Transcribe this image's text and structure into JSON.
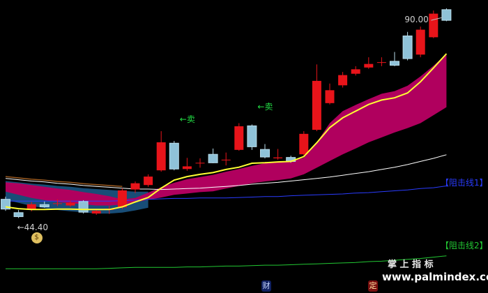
{
  "colors": {
    "background": "#000000",
    "up": "#e8141a",
    "down": "#b8dcea",
    "ma_short": "#ffff33",
    "ma_long": "#ffffff",
    "band": "#b0005e",
    "resist1": "#2a3cff",
    "resist2": "#22c833",
    "sell_text": "#22dd44"
  },
  "labels": {
    "high_price": "90.00",
    "low_price": "←44.40",
    "sell_1": "←卖",
    "sell_2": "←卖",
    "resistance_1": "【阻击线1】",
    "resistance_2": "【阻击线2】",
    "watermark_cn": "掌 上 指 标",
    "watermark_url": "www.palmindex.com",
    "icon_cai": "财",
    "icon_ding": "定",
    "money_bag_icon": "money-bag-icon"
  },
  "chart_data": {
    "type": "candlestick",
    "title": "",
    "ylim": [
      30,
      93
    ],
    "max_label": 90.0,
    "min_label": 44.4,
    "candles": [
      {
        "o": 49.8,
        "c": 47.6,
        "h": 50.4,
        "l": 47.2
      },
      {
        "o": 46.8,
        "c": 45.9,
        "h": 47.4,
        "l": 45.6
      },
      {
        "o": 47.4,
        "c": 48.7,
        "h": 49.2,
        "l": 47.1
      },
      {
        "o": 48.6,
        "c": 48.1,
        "h": 49.3,
        "l": 47.9
      },
      {
        "o": 48.9,
        "c": 48.9,
        "h": 49.8,
        "l": 48.3
      },
      {
        "o": 48.4,
        "c": 49.0,
        "h": 49.5,
        "l": 48.1
      },
      {
        "o": 49.3,
        "c": 46.9,
        "h": 49.6,
        "l": 46.6
      },
      {
        "o": 46.6,
        "c": 47.2,
        "h": 47.6,
        "l": 46.3
      },
      {
        "o": 47.4,
        "c": 47.7,
        "h": 48.3,
        "l": 46.5
      },
      {
        "o": 48.0,
        "c": 51.8,
        "h": 52.3,
        "l": 47.6
      },
      {
        "o": 52.0,
        "c": 53.4,
        "h": 53.8,
        "l": 51.2
      },
      {
        "o": 53.0,
        "c": 54.9,
        "h": 55.4,
        "l": 52.6
      },
      {
        "o": 56.3,
        "c": 62.6,
        "h": 65.1,
        "l": 56.0
      },
      {
        "o": 62.4,
        "c": 56.6,
        "h": 62.9,
        "l": 56.3
      },
      {
        "o": 56.6,
        "c": 57.2,
        "h": 59.1,
        "l": 56.2
      },
      {
        "o": 58.0,
        "c": 58.0,
        "h": 59.0,
        "l": 56.9
      },
      {
        "o": 59.9,
        "c": 58.0,
        "h": 61.2,
        "l": 57.9
      },
      {
        "o": 58.7,
        "c": 58.7,
        "h": 60.3,
        "l": 57.4
      },
      {
        "o": 60.9,
        "c": 66.2,
        "h": 66.9,
        "l": 60.7
      },
      {
        "o": 66.3,
        "c": 61.6,
        "h": 66.6,
        "l": 60.9
      },
      {
        "o": 61.0,
        "c": 59.3,
        "h": 62.2,
        "l": 59.0
      },
      {
        "o": 59.0,
        "c": 59.2,
        "h": 61.1,
        "l": 58.7
      },
      {
        "o": 59.2,
        "c": 58.3,
        "h": 59.6,
        "l": 58.0
      },
      {
        "o": 59.9,
        "c": 64.5,
        "h": 65.1,
        "l": 59.6
      },
      {
        "o": 65.4,
        "c": 76.4,
        "h": 80.1,
        "l": 65.1
      },
      {
        "o": 71.4,
        "c": 74.3,
        "h": 75.8,
        "l": 71.1
      },
      {
        "o": 75.4,
        "c": 77.7,
        "h": 78.4,
        "l": 74.9
      },
      {
        "o": 78.0,
        "c": 79.0,
        "h": 79.7,
        "l": 77.6
      },
      {
        "o": 79.4,
        "c": 80.2,
        "h": 81.7,
        "l": 79.1
      },
      {
        "o": 80.6,
        "c": 80.6,
        "h": 81.7,
        "l": 79.7
      },
      {
        "o": 80.8,
        "c": 79.9,
        "h": 82.9,
        "l": 79.7
      },
      {
        "o": 86.5,
        "c": 81.4,
        "h": 87.4,
        "l": 81.0
      },
      {
        "o": 82.3,
        "c": 87.9,
        "h": 88.6,
        "l": 81.7
      },
      {
        "o": 86.2,
        "c": 91.5,
        "h": 92.2,
        "l": 86.0
      },
      {
        "o": 92.4,
        "c": 90.0,
        "h": 92.7,
        "l": 89.8
      }
    ],
    "ma_short": [
      48.1,
      47.7,
      47.5,
      47.5,
      47.6,
      47.6,
      47.5,
      47.5,
      47.5,
      48.1,
      49.2,
      50.2,
      52.3,
      54.1,
      54.9,
      55.4,
      55.8,
      56.5,
      57.0,
      57.9,
      58.0,
      58.2,
      58.3,
      59.4,
      62.5,
      65.9,
      68.1,
      69.6,
      71.1,
      72.1,
      72.6,
      73.7,
      76.2,
      79.3,
      82.5
    ],
    "ma_long": [
      54.5,
      54.2,
      53.9,
      53.7,
      53.4,
      53.2,
      52.9,
      52.7,
      52.5,
      52.3,
      52.1,
      52.1,
      52.0,
      52.1,
      52.2,
      52.3,
      52.5,
      52.7,
      52.9,
      53.2,
      53.4,
      53.6,
      53.9,
      54.2,
      54.5,
      54.8,
      55.2,
      55.6,
      56.0,
      56.5,
      57.0,
      57.6,
      58.3,
      59.0,
      59.8
    ],
    "band_upper": [
      53.6,
      53.4,
      53.0,
      52.6,
      52.2,
      51.9,
      51.4,
      51.0,
      50.5,
      49.8,
      50.1,
      51.3,
      52.5,
      53.5,
      54.3,
      54.8,
      55.3,
      56.0,
      56.6,
      57.3,
      57.9,
      58.3,
      58.4,
      59.1,
      62.6,
      66.9,
      69.6,
      71.0,
      72.3,
      73.5,
      74.1,
      75.3,
      77.4,
      79.8,
      82.5
    ],
    "band_lower": [
      51.5,
      50.8,
      50.1,
      49.6,
      49.2,
      48.9,
      48.7,
      48.4,
      48.4,
      48.6,
      49.1,
      49.7,
      50.2,
      50.8,
      51.1,
      51.4,
      51.6,
      52.2,
      52.8,
      53.4,
      53.8,
      54.1,
      54.5,
      55.4,
      56.9,
      58.4,
      59.9,
      61.2,
      62.6,
      63.7,
      64.8,
      65.8,
      66.9,
      68.7,
      70.5
    ],
    "resist_1": [
      49.4,
      49.4,
      49.4,
      49.4,
      49.4,
      49.4,
      49.4,
      49.4,
      49.4,
      49.5,
      49.6,
      49.8,
      49.9,
      50.0,
      50.0,
      50.1,
      50.1,
      50.1,
      50.2,
      50.3,
      50.4,
      50.4,
      50.6,
      50.7,
      50.8,
      50.9,
      51.0,
      51.2,
      51.3,
      51.5,
      51.7,
      51.9,
      52.2,
      52.4,
      52.8
    ],
    "resist_2": [
      34.2,
      34.2,
      34.2,
      34.2,
      34.2,
      34.2,
      34.2,
      34.2,
      34.3,
      34.4,
      34.5,
      34.5,
      34.5,
      34.5,
      34.6,
      34.6,
      34.7,
      34.8,
      34.8,
      34.9,
      35.0,
      35.0,
      35.1,
      35.2,
      35.3,
      35.4,
      35.5,
      35.6,
      35.8,
      35.9,
      36.1,
      36.3,
      36.5,
      36.8,
      37.1
    ]
  }
}
